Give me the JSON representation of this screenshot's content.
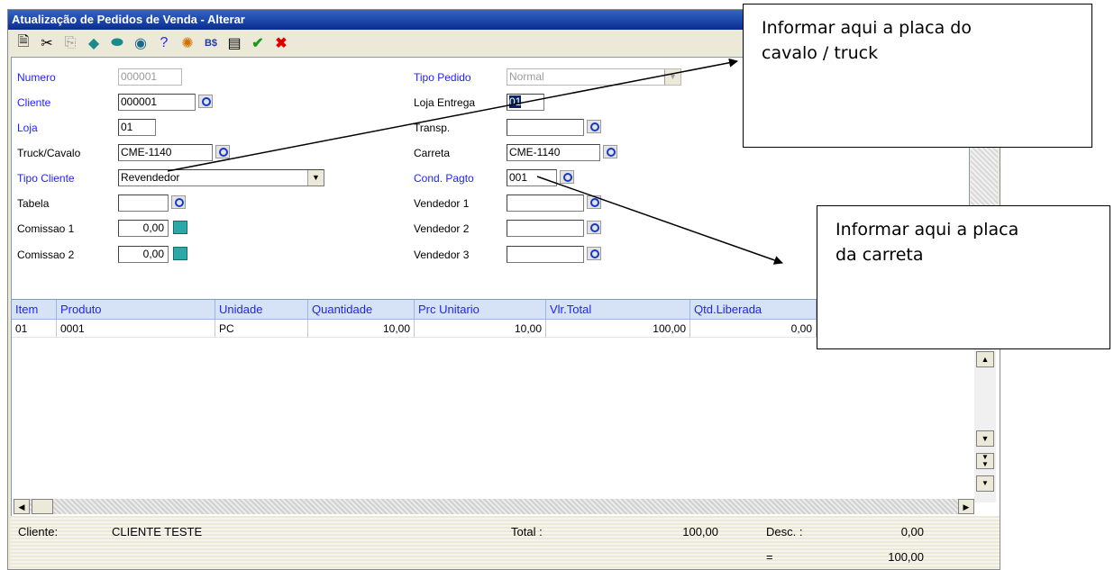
{
  "window": {
    "title": "Atualização de Pedidos de Venda - Alterar"
  },
  "toolbar": {
    "icons": [
      "document-icon",
      "scissors-icon",
      "copy-icon",
      "eraser-icon",
      "erase-all-icon",
      "disk-icon",
      "help-icon",
      "wizard-icon",
      "currency-icon",
      "list-icon",
      "confirm-icon",
      "cancel-icon"
    ]
  },
  "form": {
    "numero": {
      "label": "Numero",
      "value": "000001"
    },
    "cliente": {
      "label": "Cliente",
      "value": "000001"
    },
    "loja": {
      "label": "Loja",
      "value": "01"
    },
    "truck": {
      "label": "Truck/Cavalo",
      "value": "CME-1140"
    },
    "tipo_cliente": {
      "label": "Tipo Cliente",
      "value": "Revendedor"
    },
    "tabela": {
      "label": "Tabela",
      "value": ""
    },
    "comissao1": {
      "label": "Comissao 1",
      "value": "0,00"
    },
    "comissao2": {
      "label": "Comissao 2",
      "value": "0,00"
    },
    "tipo_pedido": {
      "label": "Tipo Pedido",
      "value": "Normal"
    },
    "loja_entrega": {
      "label": "Loja Entrega",
      "value": "01"
    },
    "transp": {
      "label": "Transp.",
      "value": ""
    },
    "carreta": {
      "label": "Carreta",
      "value": "CME-1140"
    },
    "cond_pagto": {
      "label": "Cond. Pagto",
      "value": "001"
    },
    "vendedor1": {
      "label": "Vendedor 1",
      "value": ""
    },
    "vendedor2": {
      "label": "Vendedor 2",
      "value": ""
    },
    "vendedor3": {
      "label": "Vendedor 3",
      "value": ""
    }
  },
  "grid": {
    "headers": [
      "Item",
      "Produto",
      "Unidade",
      "Quantidade",
      "Prc Unitario",
      "Vlr.Total",
      "Qtd.Liberada"
    ],
    "row": [
      "01",
      "0001",
      "PC",
      "10,00",
      "10,00",
      "100,00",
      "0,00"
    ]
  },
  "footer": {
    "cliente_label": "Cliente:",
    "cliente_value": "CLIENTE TESTE",
    "total_label": "Total :",
    "total_value": "100,00",
    "desc_label": "Desc. :",
    "desc_value": "0,00",
    "eq_label": "=",
    "eq_value": "100,00"
  },
  "callouts": {
    "cavalo_line1": "Informar aqui a placa do",
    "cavalo_line2": "cavalo / truck",
    "carreta_line1": "Informar aqui a placa",
    "carreta_line2": "da carreta"
  },
  "colors": {
    "title_bar": "#0a2d8f",
    "required_label": "#1f1fff",
    "grid_header": "#d6e3f7"
  }
}
